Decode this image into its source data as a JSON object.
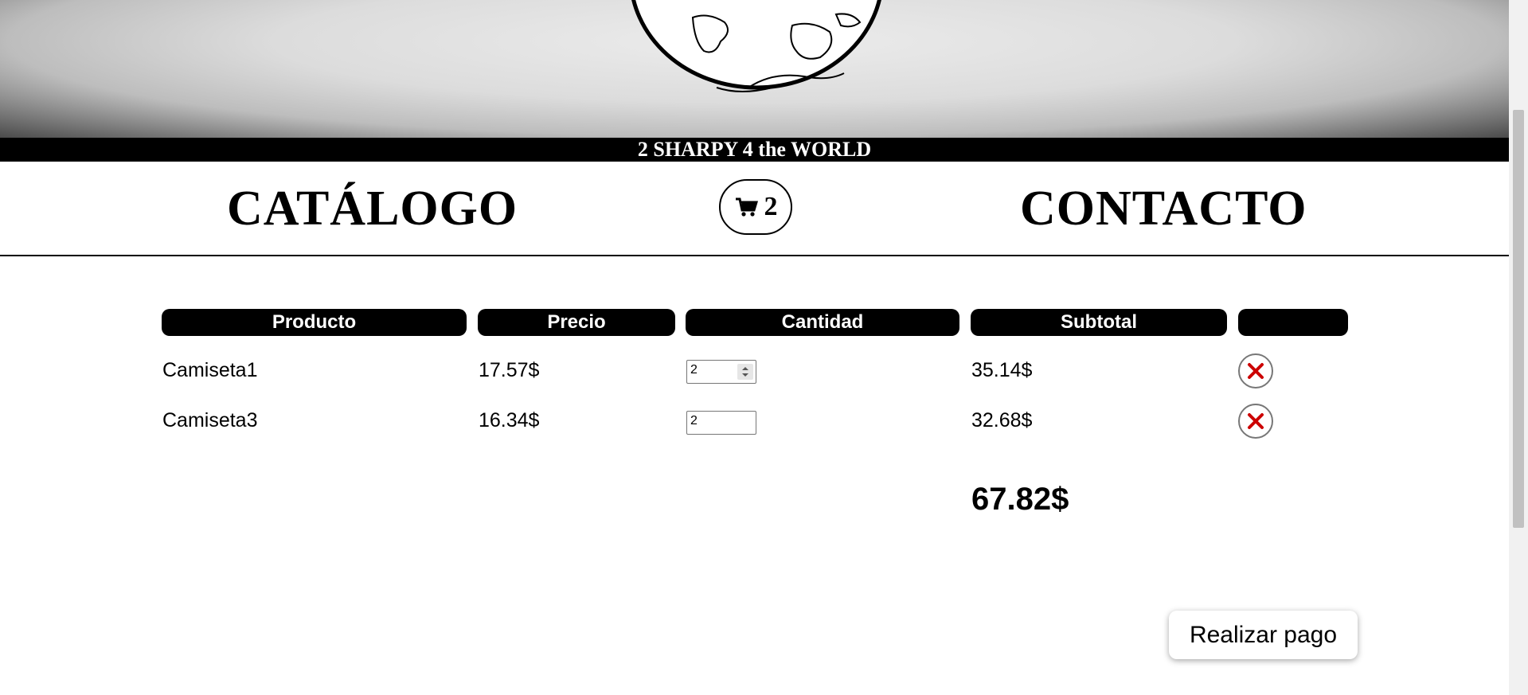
{
  "header": {
    "tagline": "2 SHARPY 4 the WORLD"
  },
  "nav": {
    "catalog": "CATÁLOGO",
    "cart_count": "2",
    "contact": "CONTACTO"
  },
  "cart_table": {
    "headers": [
      "Producto",
      "Precio",
      "Cantidad",
      "Subtotal",
      ""
    ],
    "rows": [
      {
        "product": "Camiseta1",
        "price": "17.57$",
        "quantity": "2",
        "subtotal": "35.14$"
      },
      {
        "product": "Camiseta3",
        "price": "16.34$",
        "quantity": "2",
        "subtotal": "32.68$"
      }
    ],
    "total": "67.82$"
  },
  "actions": {
    "pay_label": "Realizar pago"
  },
  "colors": {
    "remove_icon": "#cc0000",
    "header_bg": "#000000"
  }
}
